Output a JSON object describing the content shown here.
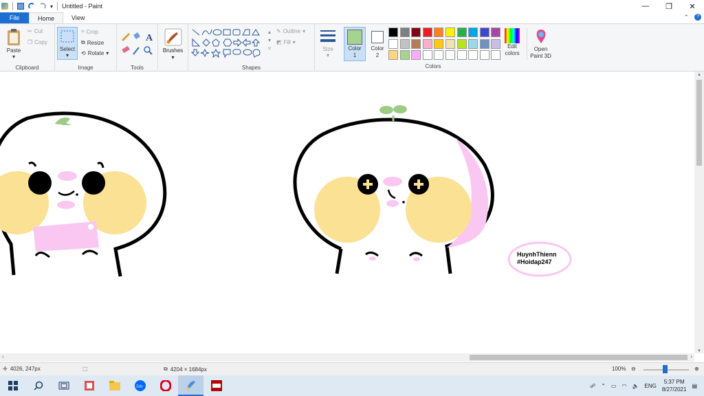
{
  "window": {
    "title": "Untitled - Paint",
    "minimize": "—",
    "restore": "❐",
    "close": "✕"
  },
  "tabs": [
    {
      "label": "File"
    },
    {
      "label": "Home"
    },
    {
      "label": "View"
    }
  ],
  "ribbon": {
    "clipboard": {
      "paste": "Paste",
      "cut": "Cut",
      "copy": "Copy",
      "label": "Clipboard"
    },
    "image": {
      "select": "Select",
      "crop": "Crop",
      "resize": "Resize",
      "rotate": "Rotate",
      "label": "Image"
    },
    "tools": {
      "label": "Tools"
    },
    "brushes": {
      "label": "Brushes"
    },
    "shapes": {
      "outline": "Outline",
      "fill": "Fill",
      "label": "Shapes"
    },
    "size": {
      "label": "Size"
    },
    "color1": {
      "label": "Color 1",
      "value": "#a6d38f"
    },
    "color2": {
      "label": "Color 2",
      "value": "#ffffff"
    },
    "colors": {
      "label": "Colors",
      "swatches": [
        "#000000",
        "#7f7f7f",
        "#880015",
        "#ed1c24",
        "#ff7f27",
        "#fff200",
        "#22b14c",
        "#00a2e8",
        "#3f48cc",
        "#a349a4",
        "#ffffff",
        "#c3c3c3",
        "#b97a57",
        "#ffaec9",
        "#ffc90e",
        "#efe4b0",
        "#b5e61d",
        "#99d9ea",
        "#7092be",
        "#c8bfe7",
        "#ffd680",
        "#a6d38f",
        "#ffaaff",
        "#ffffff",
        "#ffffff",
        "#ffffff",
        "#ffffff",
        "#ffffff",
        "#ffffff",
        "#ffffff"
      ]
    },
    "edit_colors": "Edit colors",
    "open_paint3d": "Open Paint 3D"
  },
  "canvas": {
    "watermark_line1": "HuynhThienn",
    "watermark_line2": "#Hoidap247"
  },
  "status": {
    "cursor": "4026, 247px",
    "dimensions": "4204 × 1684px",
    "zoom": "100%"
  },
  "taskbar": {
    "lang": "ENG",
    "time": "5:37 PM",
    "date": "8/27/2021"
  }
}
